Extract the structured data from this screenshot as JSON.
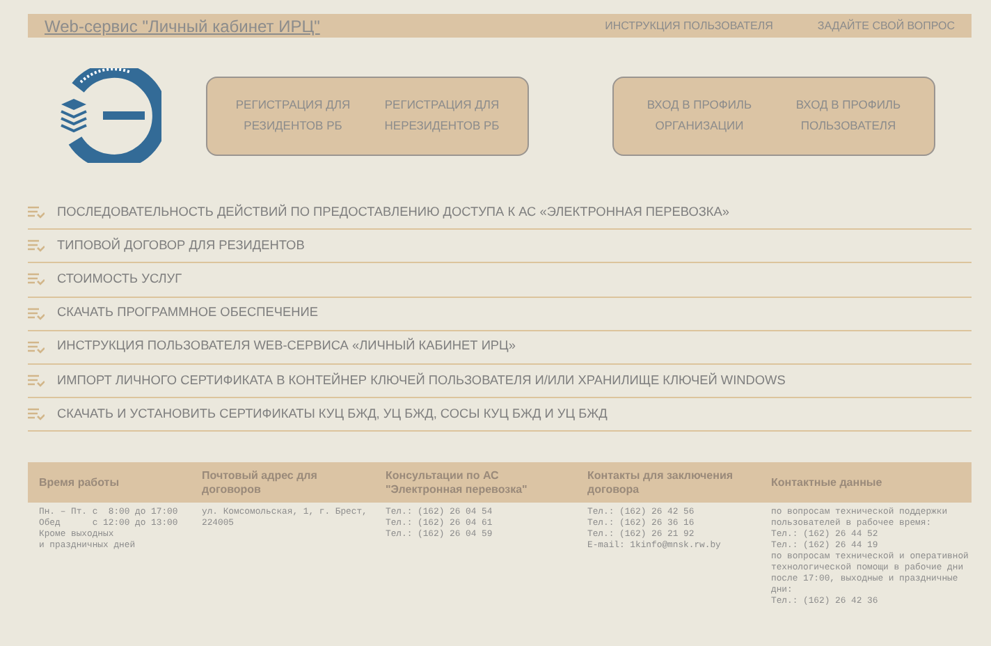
{
  "header": {
    "title": "Web-сервис \"Личный кабинет ИРЦ\"",
    "links": [
      "ИНСТРУКЦИЯ ПОЛЬЗОВАТЕЛЯ",
      "ЗАДАЙТЕ СВОЙ ВОПРОС"
    ]
  },
  "button_groups": [
    {
      "buttons": [
        "РЕГИСТРАЦИЯ ДЛЯ РЕЗИДЕНТОВ РБ",
        "РЕГИСТРАЦИЯ ДЛЯ НЕРЕЗИДЕНТОВ РБ"
      ]
    },
    {
      "buttons": [
        "ВХОД В ПРОФИЛЬ ОРГАНИЗАЦИИ",
        "ВХОД В ПРОФИЛЬ ПОЛЬЗОВАТЕЛЯ"
      ]
    }
  ],
  "menu_items": [
    "ПОСЛЕДОВАТЕЛЬНОСТЬ ДЕЙСТВИЙ ПО ПРЕДОСТАВЛЕНИЮ ДОСТУПА К АС «ЭЛЕКТРОННАЯ ПЕРЕВОЗКА»",
    "ТИПОВОЙ ДОГОВОР ДЛЯ РЕЗИДЕНТОВ",
    "СТОИМОСТЬ УСЛУГ",
    "СКАЧАТЬ ПРОГРАММНОЕ ОБЕСПЕЧЕНИЕ",
    "ИНСТРУКЦИЯ ПОЛЬЗОВАТЕЛЯ WEB-СЕРВИСА «ЛИЧНЫЙ КАБИНЕТ ИРЦ»",
    "ИМПОРТ ЛИЧНОГО СЕРТИФИКАТА В КОНТЕЙНЕР КЛЮЧЕЙ ПОЛЬЗОВАТЕЛЯ И/ИЛИ ХРАНИЛИЩЕ КЛЮЧЕЙ WINDOWS",
    "СКАЧАТЬ И УСТАНОВИТЬ СЕРТИФИКАТЫ КУЦ БЖД, УЦ БЖД, СОСЫ КУЦ БЖД И УЦ БЖД"
  ],
  "footer": {
    "columns": [
      {
        "heading": "Время работы",
        "lines": [
          "Пн. – Пт. с  8:00 до 17:00",
          "Обед      с 12:00 до 13:00",
          "Кроме выходных",
          "и праздничных дней"
        ]
      },
      {
        "heading": "Почтовый адрес для договоров",
        "lines": [
          "ул. Комсомольская, 1, г. Брест,",
          "224005"
        ]
      },
      {
        "heading": "Консультации по АС \"Электронная перевозка\"",
        "lines": [
          "Тел.: (162) 26 04 54",
          "Тел.: (162) 26 04 61",
          "Тел.: (162) 26 04 59"
        ]
      },
      {
        "heading": "Контакты для заключения договора",
        "lines": [
          "Тел.: (162) 26 42 56",
          "Тел.: (162) 26 36 16",
          "Тел.: (162) 26 21 92",
          "E-mail: 1kinfo@mnsk.rw.by"
        ]
      },
      {
        "heading": "Контактные данные",
        "lines": [
          "по вопросам технической поддержки",
          "пользователей в рабочее время:",
          "Тел.: (162) 26 44 52",
          "Тел.: (162) 26 44 19",
          "по вопросам технической и оперативной",
          "технологической помощи в рабочие дни",
          "после 17:00, выходные и праздничные",
          "дни:",
          "Тел.: (162) 26 42 36"
        ]
      }
    ]
  }
}
